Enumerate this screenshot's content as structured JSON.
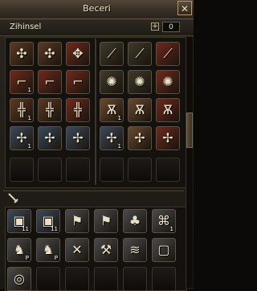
{
  "window": {
    "title": "Beceri",
    "close_label": "✕"
  },
  "tab": {
    "label": "Zihinsel",
    "plus_label": "+",
    "points": "0"
  },
  "colors": {
    "brown": "#5a3a22",
    "red": "#6e2a1c",
    "olive": "#3e3a2a",
    "slate": "#3b4a5a",
    "bronze": "#6a4a2e",
    "grey": "#4a4a4a"
  },
  "grid_skills": [
    {
      "icon": "cross-swirl-icon",
      "glyph": "✣",
      "bg": "brown"
    },
    {
      "icon": "cross-swirl-icon",
      "glyph": "✣",
      "bg": "brown"
    },
    {
      "icon": "spiral-cross-icon",
      "glyph": "✥",
      "bg": "red"
    },
    {
      "icon": "blade-icon",
      "glyph": "⟋",
      "bg": "olive"
    },
    {
      "icon": "blade-icon",
      "glyph": "⟋",
      "bg": "olive"
    },
    {
      "icon": "blade-upgrade-icon",
      "glyph": "⟋",
      "bg": "red"
    },
    {
      "icon": "boot-icon",
      "glyph": "⌐",
      "bg": "red",
      "lvl": "1"
    },
    {
      "icon": "boot-icon",
      "glyph": "⌐",
      "bg": "red"
    },
    {
      "icon": "boot-icon",
      "glyph": "⌐",
      "bg": "red"
    },
    {
      "icon": "star-rune-icon",
      "glyph": "✺",
      "bg": "olive"
    },
    {
      "icon": "star-rune-icon",
      "glyph": "✺",
      "bg": "olive"
    },
    {
      "icon": "star-rune-icon",
      "glyph": "✺",
      "bg": "red"
    },
    {
      "icon": "rune-sword-icon",
      "glyph": "╬",
      "bg": "brown",
      "lvl": "1"
    },
    {
      "icon": "rune-sword-icon",
      "glyph": "╬",
      "bg": "brown"
    },
    {
      "icon": "rune-sword-icon",
      "glyph": "╬",
      "bg": "red"
    },
    {
      "icon": "warrior-icon",
      "glyph": "Ѫ",
      "bg": "bronze",
      "lvl": "1"
    },
    {
      "icon": "warrior-icon",
      "glyph": "Ѫ",
      "bg": "bronze"
    },
    {
      "icon": "warrior-icon",
      "glyph": "Ѫ",
      "bg": "red"
    },
    {
      "icon": "pinwheel-icon",
      "glyph": "✢",
      "bg": "slate",
      "lvl": "1"
    },
    {
      "icon": "pinwheel-icon",
      "glyph": "✢",
      "bg": "slate"
    },
    {
      "icon": "pinwheel-icon",
      "glyph": "✢",
      "bg": "slate"
    },
    {
      "icon": "pinwheel-icon",
      "glyph": "✢",
      "bg": "slate",
      "lvl": "1"
    },
    {
      "icon": "pinwheel-icon",
      "glyph": "✢",
      "bg": "bronze"
    },
    {
      "icon": "pinwheel-icon",
      "glyph": "✢",
      "bg": "red"
    }
  ],
  "bottom_skills": [
    {
      "icon": "shield-scroll-icon",
      "glyph": "▣",
      "bg": "slate",
      "lvl": "11"
    },
    {
      "icon": "shield-scroll-icon",
      "glyph": "▣",
      "bg": "slate",
      "lvl": "11"
    },
    {
      "icon": "flag-icon",
      "glyph": "⚑",
      "bg": "grey"
    },
    {
      "icon": "flag-up-icon",
      "glyph": "⚑",
      "bg": "grey"
    },
    {
      "icon": "group-icon",
      "glyph": "♣",
      "bg": "grey"
    },
    {
      "icon": "knot-icon",
      "glyph": "⌘",
      "bg": "grey",
      "lvl": "1"
    },
    {
      "icon": "horse-icon",
      "glyph": "♞",
      "bg": "grey",
      "lvl": "P"
    },
    {
      "icon": "horse-icon",
      "glyph": "♞",
      "bg": "grey",
      "lvl": "P"
    },
    {
      "icon": "crossbow-icon",
      "glyph": "✕",
      "bg": "grey"
    },
    {
      "icon": "pick-icon",
      "glyph": "⚒",
      "bg": "grey"
    },
    {
      "icon": "wheat-icon",
      "glyph": "≋",
      "bg": "grey"
    },
    {
      "icon": "lock-icon",
      "glyph": "▢",
      "bg": "grey"
    },
    {
      "icon": "target-icon",
      "glyph": "◎",
      "bg": "grey"
    }
  ]
}
